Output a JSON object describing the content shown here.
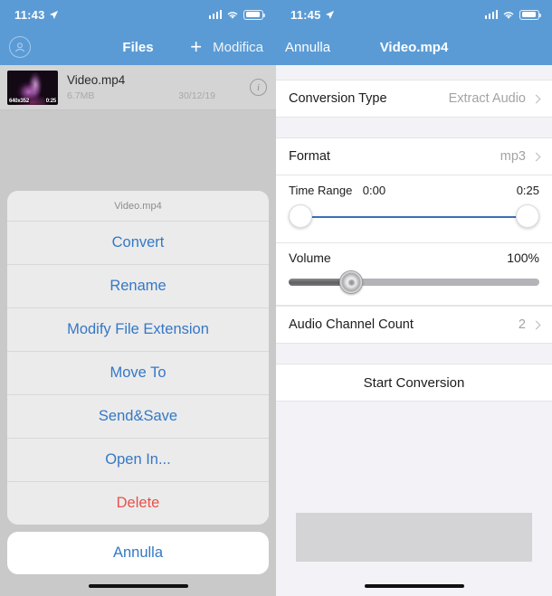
{
  "left_screen": {
    "status_bar": {
      "time": "11:43",
      "location_icon": "location-arrow-icon",
      "signal_icon": "cellular-signal-icon",
      "wifi_icon": "wifi-icon",
      "battery_icon": "battery-icon"
    },
    "nav_bar": {
      "account_icon": "account-circle-icon",
      "title": "Files",
      "add_icon": "plus-icon",
      "edit_label": "Modifica"
    },
    "file_row": {
      "thumbnail_resolution": "640x352",
      "thumbnail_duration": "0:25",
      "name": "Video.mp4",
      "size": "6.7MB",
      "date": "30/12/19",
      "info_icon": "info-circle-icon"
    },
    "action_sheet": {
      "title": "Video.mp4",
      "items": [
        {
          "label": "Convert",
          "style": "default"
        },
        {
          "label": "Rename",
          "style": "default"
        },
        {
          "label": "Modify File Extension",
          "style": "default"
        },
        {
          "label": "Move To",
          "style": "default"
        },
        {
          "label": "Send&Save",
          "style": "default"
        },
        {
          "label": "Open In...",
          "style": "default"
        },
        {
          "label": "Delete",
          "style": "destructive"
        }
      ],
      "cancel_label": "Annulla"
    }
  },
  "right_screen": {
    "status_bar": {
      "time": "11:45",
      "location_icon": "location-arrow-icon",
      "signal_icon": "cellular-signal-icon",
      "wifi_icon": "wifi-icon",
      "battery_icon": "battery-icon"
    },
    "nav_bar": {
      "back_label": "Annulla",
      "title": "Video.mp4"
    },
    "settings": {
      "conversion_type": {
        "label": "Conversion Type",
        "value": "Extract Audio"
      },
      "format": {
        "label": "Format",
        "value": "mp3"
      },
      "time_range": {
        "label": "Time Range",
        "start": "0:00",
        "end": "0:25"
      },
      "volume": {
        "label": "Volume",
        "value": "100%",
        "thumb_position_percent": 25
      },
      "audio_channel_count": {
        "label": "Audio Channel Count",
        "value": "2"
      },
      "start_button": "Start Conversion"
    }
  },
  "colors": {
    "nav_blue": "#5b9bd5",
    "link_blue": "#3478c6",
    "destructive_red": "#e8524a",
    "slider_blue": "#3b6fb5",
    "panel_bg": "#f2f2f7"
  }
}
